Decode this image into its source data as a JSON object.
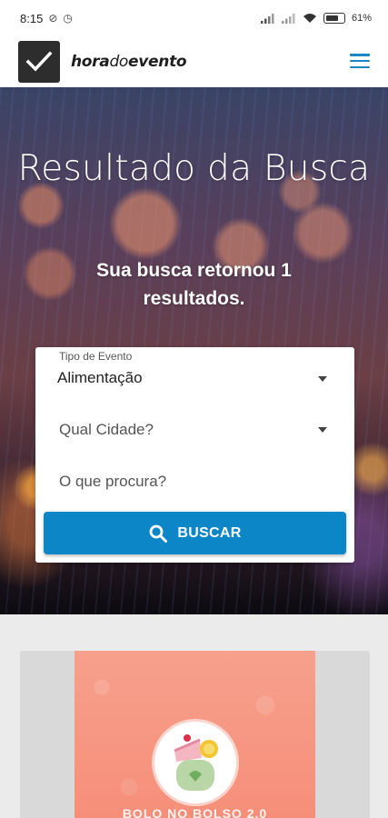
{
  "status_bar": {
    "time": "8:15",
    "battery_text": "61%",
    "icons": [
      "no-disturb-icon",
      "alarm-icon",
      "signal-icon",
      "signal-icon",
      "wifi-icon",
      "battery-icon"
    ]
  },
  "header": {
    "logo_hora": "hora",
    "logo_do": "do",
    "logo_evento": "evento",
    "menu_icon": "hamburger-menu-icon"
  },
  "hero": {
    "title": "Resultado da Busca",
    "subtitle": "Sua busca retornou 1 resultados."
  },
  "search": {
    "event_type_label": "Tipo de Evento",
    "event_type_value": "Alimentação",
    "city_placeholder": "Qual Cidade?",
    "query_placeholder": "O que procura?",
    "button_label": "BUSCAR"
  },
  "results": [
    {
      "name": "BOLO NO BOLSO 2.0"
    }
  ],
  "colors": {
    "accent": "#0d86c8",
    "menu": "#1a86c8",
    "card_bg": "#f5917c"
  }
}
